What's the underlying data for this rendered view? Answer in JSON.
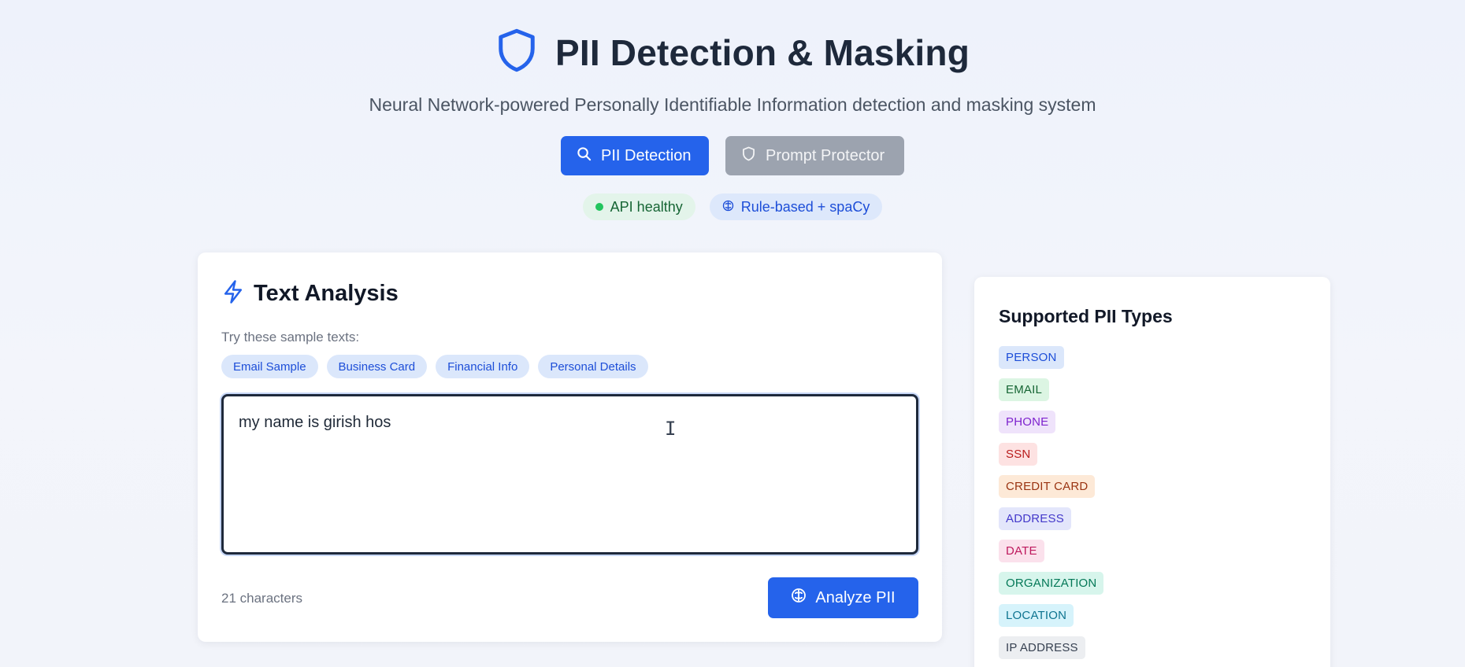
{
  "header": {
    "title": "PII Detection & Masking",
    "subtitle": "Neural Network-powered Personally Identifiable Information detection and masking system",
    "icon": "shield-icon",
    "accent": "#2563eb"
  },
  "modes": [
    {
      "label": "PII Detection",
      "icon": "search-icon",
      "active": true
    },
    {
      "label": "Prompt Protector",
      "icon": "shield-icon",
      "active": false
    }
  ],
  "status": {
    "health_label": "API healthy",
    "engine_label": "Rule-based + spaCy",
    "health_color": "#22c55e"
  },
  "analysis": {
    "title": "Text Analysis",
    "title_icon": "lightning-icon",
    "sample_label": "Try these sample texts:",
    "samples": [
      "Email Sample",
      "Business Card",
      "Financial Info",
      "Personal Details"
    ],
    "input_value": "my name is girish hos",
    "char_count": "21 characters",
    "analyze_label": "Analyze PII",
    "analyze_icon": "brain-icon"
  },
  "pii_types": {
    "title": "Supported PII Types",
    "items": [
      {
        "label": "PERSON",
        "bg": "#dbe7fb",
        "fg": "#1d4ed8"
      },
      {
        "label": "EMAIL",
        "bg": "#dcf5e3",
        "fg": "#166534"
      },
      {
        "label": "PHONE",
        "bg": "#efe3fb",
        "fg": "#7e22ce"
      },
      {
        "label": "SSN",
        "bg": "#fde2e2",
        "fg": "#b91c1c"
      },
      {
        "label": "CREDIT CARD",
        "bg": "#fde9d7",
        "fg": "#9a3412"
      },
      {
        "label": "ADDRESS",
        "bg": "#e3e6fb",
        "fg": "#4338ca"
      },
      {
        "label": "DATE",
        "bg": "#fbe1ec",
        "fg": "#be185d"
      },
      {
        "label": "ORGANIZATION",
        "bg": "#d7f5ec",
        "fg": "#047857"
      },
      {
        "label": "LOCATION",
        "bg": "#d6f3fb",
        "fg": "#0e7490"
      },
      {
        "label": "IP ADDRESS",
        "bg": "#eceef1",
        "fg": "#374151"
      }
    ]
  }
}
